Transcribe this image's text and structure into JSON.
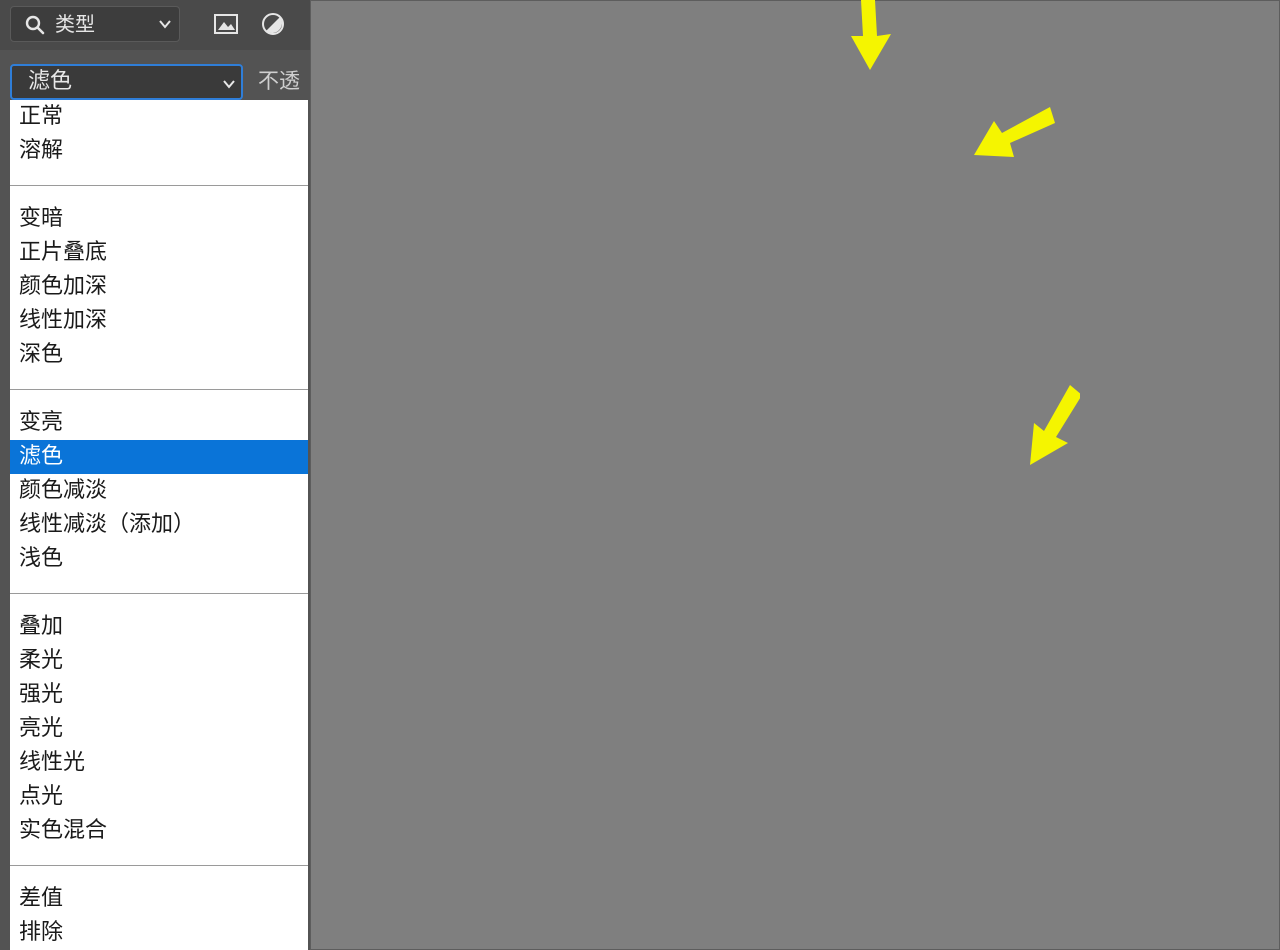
{
  "filter": {
    "label": "类型",
    "icon": "search-icon"
  },
  "toolbar_icons": [
    "image-filter-icon",
    "adjustment-filter-icon"
  ],
  "blend_mode": {
    "selected": "滤色",
    "opacity_label": "不透"
  },
  "menu": {
    "group1": [
      "正常",
      "溶解"
    ],
    "group2": [
      "变暗",
      "正片叠底",
      "颜色加深",
      "线性加深",
      "深色"
    ],
    "group3": [
      "变亮",
      "滤色",
      "颜色减淡",
      "线性减淡（添加）",
      "浅色"
    ],
    "group4": [
      "叠加",
      "柔光",
      "强光",
      "亮光",
      "线性光",
      "点光",
      "实色混合"
    ],
    "group5": [
      "差值",
      "排除"
    ]
  },
  "selected_item": "滤色",
  "canvas": {
    "description_image": "photo-placeholder"
  },
  "colors": {
    "accent": "#0a74d8",
    "arrow": "#f5f500"
  }
}
